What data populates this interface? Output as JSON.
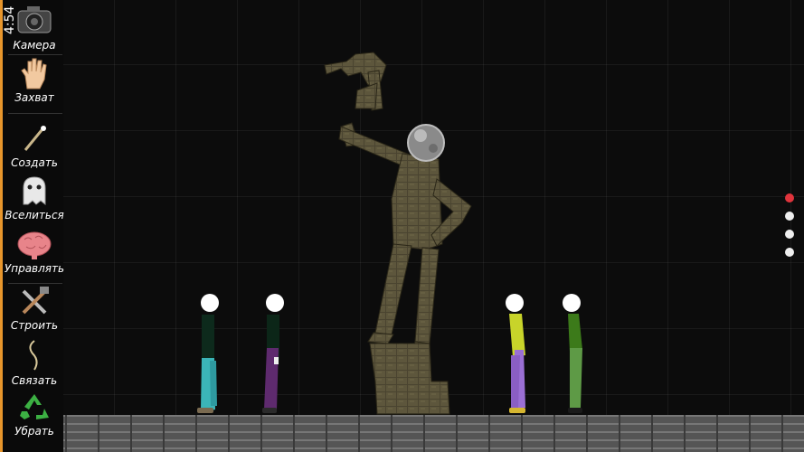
{
  "status": {
    "time": "4:54"
  },
  "toolbar": {
    "tools": [
      {
        "label": "Камера",
        "icon": "camera-icon"
      },
      {
        "label": "Захват",
        "icon": "hand-icon"
      },
      {
        "label": "Создать",
        "icon": "wand-icon"
      },
      {
        "label": "Вселиться",
        "icon": "ghost-icon"
      },
      {
        "label": "Управлять",
        "icon": "brain-icon"
      },
      {
        "label": "Строить",
        "icon": "tools-icon"
      },
      {
        "label": "Связать",
        "icon": "rope-icon"
      },
      {
        "label": "Убрать",
        "icon": "recycle-icon"
      }
    ]
  },
  "page_indicator": {
    "count": 4,
    "active_index": 0
  },
  "colors": {
    "accent": "#e8962c",
    "active_dot": "#e0343c"
  },
  "characters": [
    {
      "name": "ragdoll-teal",
      "shirt": "#0d2a1c",
      "pants": "#3bb5b8"
    },
    {
      "name": "ragdoll-purple",
      "shirt": "#0c2618",
      "pants": "#5e2a6e"
    },
    {
      "name": "ragdoll-yellow",
      "shirt": "#c8d42a",
      "pants": "#9a6fd4"
    },
    {
      "name": "ragdoll-green",
      "shirt": "#3c7a1a",
      "pants": "#5e9a46"
    }
  ]
}
